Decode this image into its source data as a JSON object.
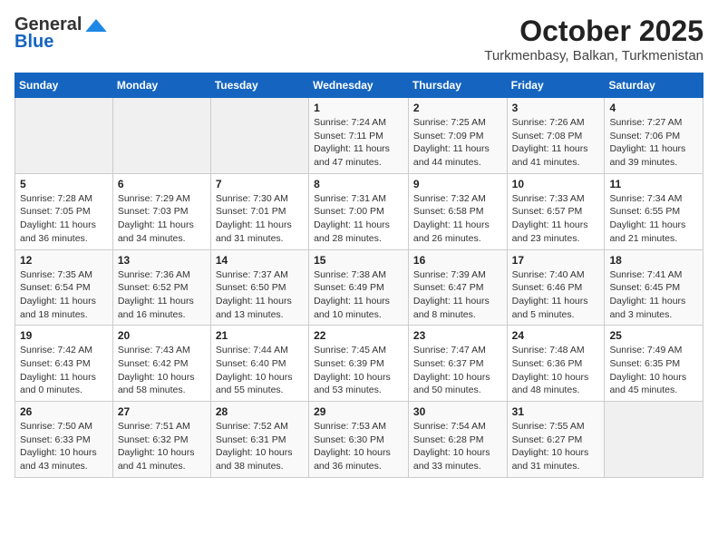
{
  "logo": {
    "general": "General",
    "blue": "Blue"
  },
  "title": "October 2025",
  "subtitle": "Turkmenbasy, Balkan, Turkmenistan",
  "days_of_week": [
    "Sunday",
    "Monday",
    "Tuesday",
    "Wednesday",
    "Thursday",
    "Friday",
    "Saturday"
  ],
  "weeks": [
    [
      {
        "num": "",
        "info": ""
      },
      {
        "num": "",
        "info": ""
      },
      {
        "num": "",
        "info": ""
      },
      {
        "num": "1",
        "info": "Sunrise: 7:24 AM\nSunset: 7:11 PM\nDaylight: 11 hours and 47 minutes."
      },
      {
        "num": "2",
        "info": "Sunrise: 7:25 AM\nSunset: 7:09 PM\nDaylight: 11 hours and 44 minutes."
      },
      {
        "num": "3",
        "info": "Sunrise: 7:26 AM\nSunset: 7:08 PM\nDaylight: 11 hours and 41 minutes."
      },
      {
        "num": "4",
        "info": "Sunrise: 7:27 AM\nSunset: 7:06 PM\nDaylight: 11 hours and 39 minutes."
      }
    ],
    [
      {
        "num": "5",
        "info": "Sunrise: 7:28 AM\nSunset: 7:05 PM\nDaylight: 11 hours and 36 minutes."
      },
      {
        "num": "6",
        "info": "Sunrise: 7:29 AM\nSunset: 7:03 PM\nDaylight: 11 hours and 34 minutes."
      },
      {
        "num": "7",
        "info": "Sunrise: 7:30 AM\nSunset: 7:01 PM\nDaylight: 11 hours and 31 minutes."
      },
      {
        "num": "8",
        "info": "Sunrise: 7:31 AM\nSunset: 7:00 PM\nDaylight: 11 hours and 28 minutes."
      },
      {
        "num": "9",
        "info": "Sunrise: 7:32 AM\nSunset: 6:58 PM\nDaylight: 11 hours and 26 minutes."
      },
      {
        "num": "10",
        "info": "Sunrise: 7:33 AM\nSunset: 6:57 PM\nDaylight: 11 hours and 23 minutes."
      },
      {
        "num": "11",
        "info": "Sunrise: 7:34 AM\nSunset: 6:55 PM\nDaylight: 11 hours and 21 minutes."
      }
    ],
    [
      {
        "num": "12",
        "info": "Sunrise: 7:35 AM\nSunset: 6:54 PM\nDaylight: 11 hours and 18 minutes."
      },
      {
        "num": "13",
        "info": "Sunrise: 7:36 AM\nSunset: 6:52 PM\nDaylight: 11 hours and 16 minutes."
      },
      {
        "num": "14",
        "info": "Sunrise: 7:37 AM\nSunset: 6:50 PM\nDaylight: 11 hours and 13 minutes."
      },
      {
        "num": "15",
        "info": "Sunrise: 7:38 AM\nSunset: 6:49 PM\nDaylight: 11 hours and 10 minutes."
      },
      {
        "num": "16",
        "info": "Sunrise: 7:39 AM\nSunset: 6:47 PM\nDaylight: 11 hours and 8 minutes."
      },
      {
        "num": "17",
        "info": "Sunrise: 7:40 AM\nSunset: 6:46 PM\nDaylight: 11 hours and 5 minutes."
      },
      {
        "num": "18",
        "info": "Sunrise: 7:41 AM\nSunset: 6:45 PM\nDaylight: 11 hours and 3 minutes."
      }
    ],
    [
      {
        "num": "19",
        "info": "Sunrise: 7:42 AM\nSunset: 6:43 PM\nDaylight: 11 hours and 0 minutes."
      },
      {
        "num": "20",
        "info": "Sunrise: 7:43 AM\nSunset: 6:42 PM\nDaylight: 10 hours and 58 minutes."
      },
      {
        "num": "21",
        "info": "Sunrise: 7:44 AM\nSunset: 6:40 PM\nDaylight: 10 hours and 55 minutes."
      },
      {
        "num": "22",
        "info": "Sunrise: 7:45 AM\nSunset: 6:39 PM\nDaylight: 10 hours and 53 minutes."
      },
      {
        "num": "23",
        "info": "Sunrise: 7:47 AM\nSunset: 6:37 PM\nDaylight: 10 hours and 50 minutes."
      },
      {
        "num": "24",
        "info": "Sunrise: 7:48 AM\nSunset: 6:36 PM\nDaylight: 10 hours and 48 minutes."
      },
      {
        "num": "25",
        "info": "Sunrise: 7:49 AM\nSunset: 6:35 PM\nDaylight: 10 hours and 45 minutes."
      }
    ],
    [
      {
        "num": "26",
        "info": "Sunrise: 7:50 AM\nSunset: 6:33 PM\nDaylight: 10 hours and 43 minutes."
      },
      {
        "num": "27",
        "info": "Sunrise: 7:51 AM\nSunset: 6:32 PM\nDaylight: 10 hours and 41 minutes."
      },
      {
        "num": "28",
        "info": "Sunrise: 7:52 AM\nSunset: 6:31 PM\nDaylight: 10 hours and 38 minutes."
      },
      {
        "num": "29",
        "info": "Sunrise: 7:53 AM\nSunset: 6:30 PM\nDaylight: 10 hours and 36 minutes."
      },
      {
        "num": "30",
        "info": "Sunrise: 7:54 AM\nSunset: 6:28 PM\nDaylight: 10 hours and 33 minutes."
      },
      {
        "num": "31",
        "info": "Sunrise: 7:55 AM\nSunset: 6:27 PM\nDaylight: 10 hours and 31 minutes."
      },
      {
        "num": "",
        "info": ""
      }
    ]
  ]
}
